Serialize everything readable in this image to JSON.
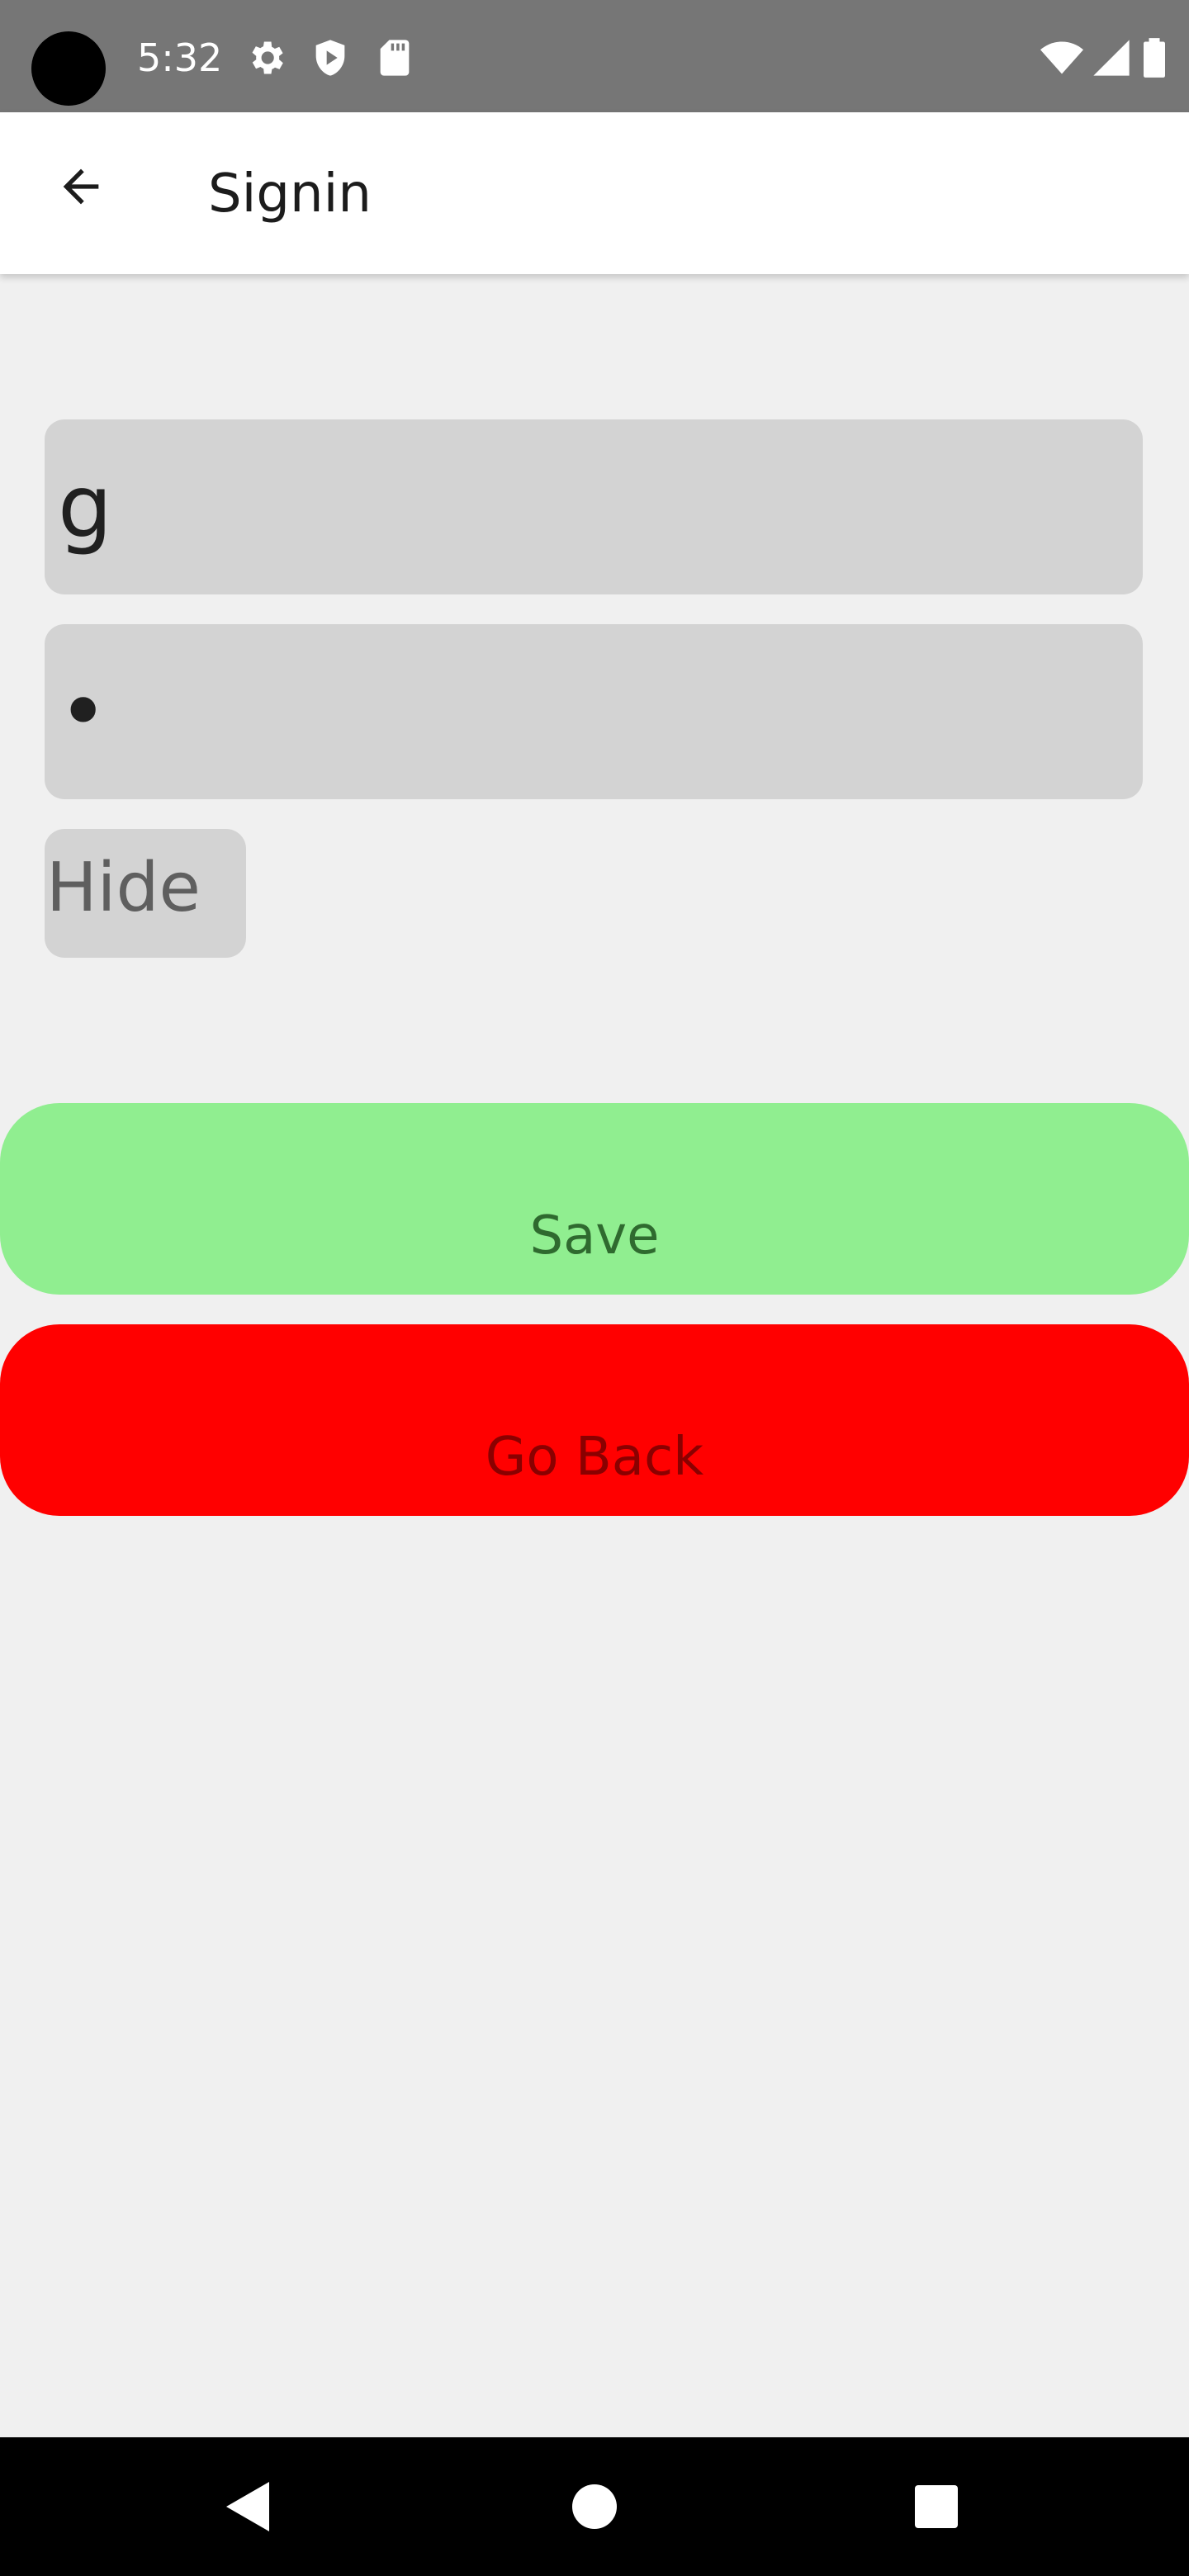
{
  "status_bar": {
    "time": "5:32",
    "icons": [
      "camera-dot",
      "gear-icon",
      "shield-icon",
      "sd-card-icon",
      "wifi-icon",
      "signal-icon",
      "battery-icon"
    ]
  },
  "app_bar": {
    "title": "Signin",
    "back_icon": "arrow-left-icon"
  },
  "form": {
    "username_value": "g",
    "password_value": "•",
    "hide_label": "Hide"
  },
  "actions": {
    "save_label": "Save",
    "go_back_label": "Go Back"
  },
  "nav_bar": {
    "icons": [
      "back-triangle-icon",
      "home-circle-icon",
      "recents-square-icon"
    ]
  },
  "colors": {
    "status_bar": "#767676",
    "app_bar": "#ffffff",
    "page_background": "#f0f0f0",
    "field_background": "#d3d3d3",
    "save_button": "#90ee90",
    "go_back_button": "#ff0000",
    "nav_bar": "#000000"
  }
}
